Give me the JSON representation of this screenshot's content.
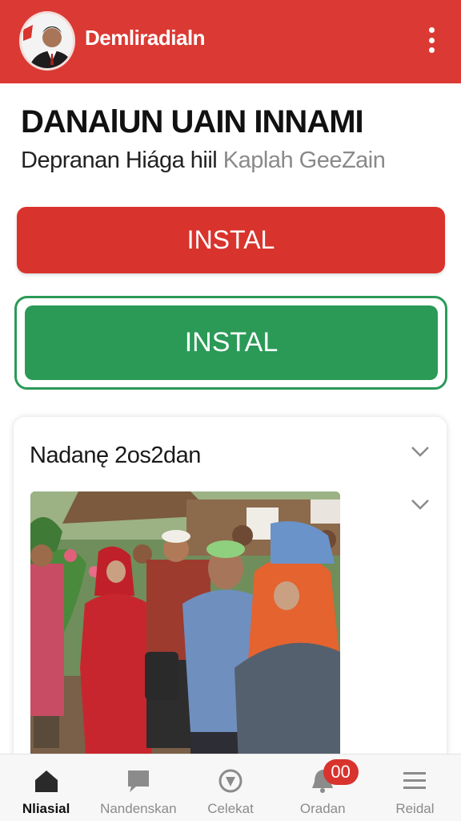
{
  "header": {
    "app_title": "Demliradialn"
  },
  "main": {
    "title": "DANAlUN UAIN INNAMI",
    "subtitle_main": "Depranan Hiága hiil",
    "subtitle_muted": "Kaplah GeeZain",
    "install_primary_label": "INSTAL",
    "install_secondary_label": "INSTAL"
  },
  "card": {
    "title": "Nadanę 2os2dan"
  },
  "bottom_nav": {
    "items": [
      {
        "label": "Nliasial",
        "icon": "home-icon",
        "active": true
      },
      {
        "label": "Nandenskan",
        "icon": "chat-icon",
        "active": false
      },
      {
        "label": "Celekat",
        "icon": "compass-icon",
        "active": false
      },
      {
        "label": "Oradan",
        "icon": "bell-icon",
        "active": false,
        "badge": "00"
      },
      {
        "label": "Reidal",
        "icon": "menu-icon",
        "active": false
      }
    ]
  },
  "colors": {
    "brand_red": "#db3a34",
    "accent_green": "#2b9a57"
  }
}
